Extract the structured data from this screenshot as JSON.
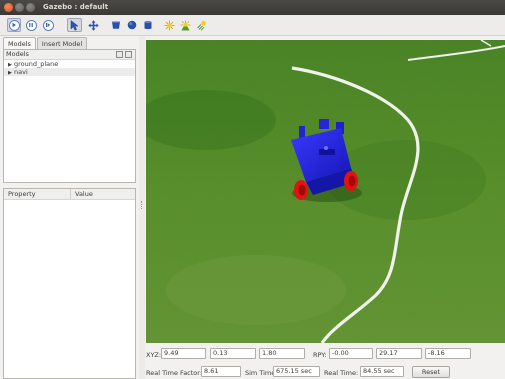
{
  "window": {
    "title": "Gazebo : default"
  },
  "toolbar": {
    "buttons": [
      "play-icon",
      "pause-icon",
      "step-icon",
      "select-arrow-icon",
      "translate-icon",
      "box-shape-icon",
      "sphere-shape-icon",
      "cylinder-shape-icon",
      "point-light-icon",
      "spot-light-icon",
      "directional-light-icon"
    ]
  },
  "left_panel": {
    "tabs": [
      {
        "label": "Models"
      },
      {
        "label": "Insert Model"
      }
    ],
    "models_header": "Models",
    "tree": [
      {
        "label": "ground_plane"
      },
      {
        "label": "navi"
      }
    ],
    "property_header": {
      "property": "Property",
      "value": "Value"
    }
  },
  "bottom_bar": {
    "xyz_label": "XYZ:",
    "x": "9.49",
    "y": "0.13",
    "z": "1.80",
    "rpy_label": "RPY:",
    "roll": "-0.00",
    "pitch": "29.17",
    "yaw": "-8.16",
    "rtf_label": "Real Time Factor:",
    "rtf": "8.61",
    "sim_time_label": "Sim Time:",
    "sim_time": "675.15 sec",
    "real_time_label": "Real Time:",
    "real_time": "84.55 sec",
    "reset_label": "Reset"
  },
  "colors": {
    "accent": "#dd4814",
    "robot_body": "#1f1fd8",
    "wheels": "#e31010",
    "grass": "#4f8a26"
  }
}
